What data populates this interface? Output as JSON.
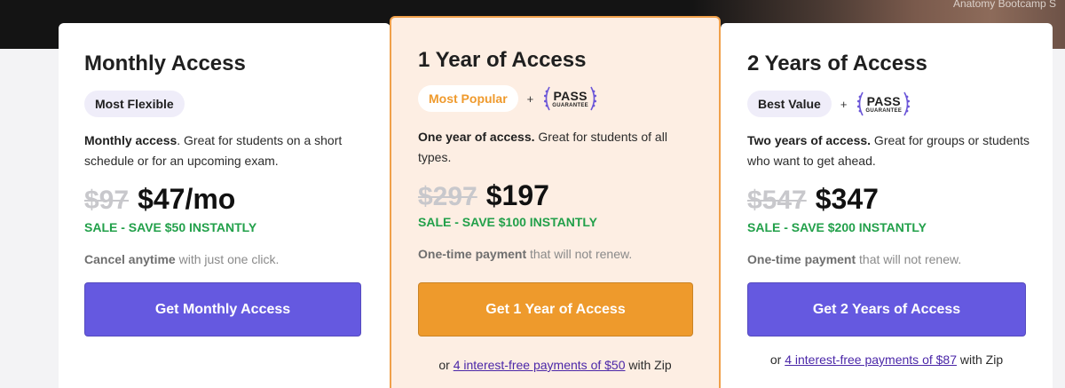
{
  "hero": {
    "caption": "Anatomy Bootcamp S"
  },
  "plans": {
    "monthly": {
      "title": "Monthly Access",
      "badge": "Most Flexible",
      "desc_bold": "Monthly access",
      "desc_rest": ". Great for students on a short schedule or for an upcoming exam.",
      "old_price": "$97",
      "new_price": "$47/mo",
      "sale": "SALE - SAVE $50 INSTANTLY",
      "note_bold": "Cancel anytime",
      "note_rest": " with just one click.",
      "cta": "Get Monthly Access"
    },
    "oneyear": {
      "title": "1 Year of Access",
      "badge": "Most Popular",
      "plus": "+",
      "pass_word": "PASS",
      "pass_guarantee": "GUARANTEE",
      "desc_bold": "One year of access.",
      "desc_rest": " Great for students of all types.",
      "old_price": "$297",
      "new_price": "$197",
      "sale": "SALE - SAVE $100 INSTANTLY",
      "note_bold": "One-time payment",
      "note_rest": " that will not renew.",
      "cta": "Get 1 Year of Access",
      "zip_prefix": "or ",
      "zip_link": "4 interest-free payments of $50",
      "zip_suffix": " with Zip"
    },
    "twoyear": {
      "title": "2 Years of Access",
      "badge": "Best Value",
      "plus": "+",
      "pass_word": "PASS",
      "pass_guarantee": "GUARANTEE",
      "desc_bold": "Two years of access.",
      "desc_rest": " Great for groups or students who want to get ahead.",
      "old_price": "$547",
      "new_price": "$347",
      "sale": "SALE - SAVE $200 INSTANTLY",
      "note_bold": "One-time payment",
      "note_rest": " that will not renew.",
      "cta": "Get 2 Years of Access",
      "zip_prefix": "or ",
      "zip_link": "4 interest-free payments of $87",
      "zip_suffix": " with Zip"
    }
  },
  "colors": {
    "purple_cta": "#6559e0",
    "orange_cta": "#ee9a2c",
    "sale_green": "#22a04a",
    "featured_bg": "#fdeee3",
    "featured_border": "#f0a04a"
  }
}
